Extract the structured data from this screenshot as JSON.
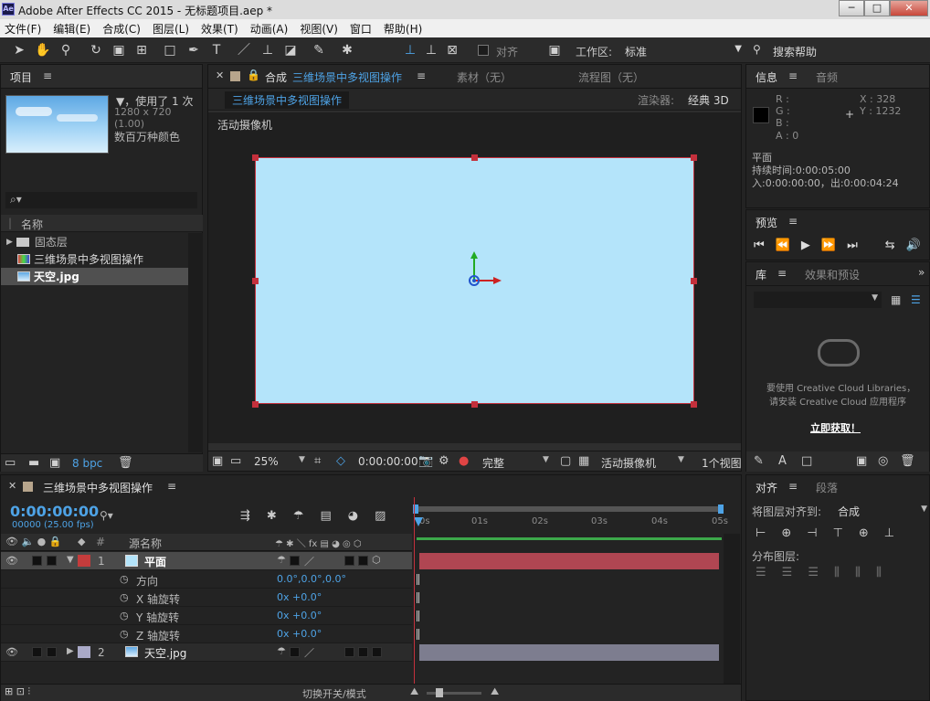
{
  "window": {
    "title": "Adobe After Effects CC 2015 - 无标题项目.aep *",
    "logo": "Ae",
    "minimize": "─",
    "maximize": "□",
    "close": "✕"
  },
  "menu": [
    "文件(F)",
    "编辑(E)",
    "合成(C)",
    "图层(L)",
    "效果(T)",
    "动画(A)",
    "视图(V)",
    "窗口",
    "帮助(H)"
  ],
  "toolbar": {
    "align_label": "对齐",
    "workspace_label": "工作区:",
    "workspace_value": "标准",
    "search_help": "搜索帮助"
  },
  "project": {
    "tab": "项目",
    "used": "▼，使用了 1 次",
    "dims": "1280 x 720 (1.00)",
    "colors": "数百万种颜色",
    "search_icon": "⌕▾",
    "col_name": "名称",
    "items": [
      {
        "name": "固态层",
        "type": "folder"
      },
      {
        "name": "三维场景中多视图操作",
        "type": "comp"
      },
      {
        "name": "天空.jpg",
        "type": "image"
      }
    ],
    "bpc": "8 bpc"
  },
  "composition": {
    "tabs": [
      {
        "label": "合成",
        "active": true
      },
      {
        "label": "素材（无）",
        "active": false
      },
      {
        "label": "流程图（无）",
        "active": false
      }
    ],
    "comp_name": "三维场景中多视图操作",
    "renderer_label": "渲染器:",
    "renderer_value": "经典 3D",
    "view_label": "活动摄像机",
    "zoom": "25%",
    "time": "0:00:00:00",
    "quality": "完整",
    "camera": "活动摄像机",
    "views": "1个视图"
  },
  "info": {
    "tab1": "信息",
    "tab2": "音频",
    "r": "R :",
    "g": "G :",
    "b": "B :",
    "a": "A : 0",
    "x": "X : 328",
    "y": "Y : 1232",
    "layer": "平面",
    "duration": "持续时间:0:00:05:00",
    "inout": "入:0:00:00:00，出:0:00:04:24"
  },
  "preview": {
    "tab": "预览"
  },
  "library": {
    "tab1": "库",
    "tab2": "效果和预设",
    "msg1": "要使用 Creative Cloud Libraries，",
    "msg2": "请安装 Creative Cloud 应用程序",
    "link": "立即获取！"
  },
  "align": {
    "tab1": "对齐",
    "tab2": "段落",
    "align_to_label": "将图层对齐到:",
    "align_to_value": "合成",
    "distribute_label": "分布图层:"
  },
  "timeline": {
    "tab": "三维场景中多视图操作",
    "timecode": "0:00:00:00",
    "frame_info": "00000 (25.00 fps)",
    "col_num": "#",
    "col_source": "源名称",
    "ruler": [
      "0s",
      "01s",
      "02s",
      "03s",
      "04s",
      "05s"
    ],
    "layers": [
      {
        "num": "1",
        "name": "平面",
        "color": "#c43c3c",
        "props": [
          {
            "name": "方向",
            "value": "0.0°,0.0°,0.0°"
          },
          {
            "name": "X 轴旋转",
            "value": "0x +0.0°"
          },
          {
            "name": "Y 轴旋转",
            "value": "0x +0.0°"
          },
          {
            "name": "Z 轴旋转",
            "value": "0x +0.0°"
          }
        ]
      },
      {
        "num": "2",
        "name": "天空.jpg",
        "color": "#aaaac8"
      }
    ],
    "toggle_label": "切换开关/模式"
  },
  "colors": {
    "accent": "#4ea3e6",
    "sky": "#b4e4fa",
    "selection": "#c4303c"
  }
}
